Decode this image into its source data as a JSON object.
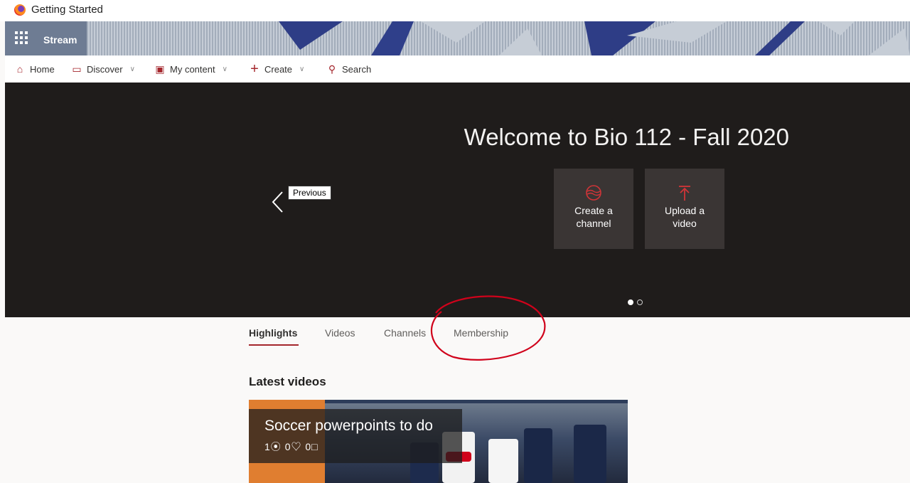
{
  "browser": {
    "tab_title": "Getting Started"
  },
  "suite": {
    "app_name": "Stream"
  },
  "nav": {
    "home": "Home",
    "discover": "Discover",
    "my_content": "My content",
    "create": "Create",
    "search": "Search"
  },
  "hero": {
    "title": "Welcome to Bio 112 - Fall 2020",
    "prev_tooltip": "Previous",
    "tiles": [
      {
        "line1": "Create a",
        "line2": "channel",
        "icon": "channel-icon"
      },
      {
        "line1": "Upload a",
        "line2": "video",
        "icon": "upload-icon"
      }
    ],
    "pager": {
      "count": 2,
      "active": 1
    }
  },
  "tabs": [
    "Highlights",
    "Videos",
    "Channels",
    "Membership"
  ],
  "active_tab": "Highlights",
  "latest": {
    "heading": "Latest videos",
    "video": {
      "title": "Soccer powerpoints to do",
      "views": "1",
      "likes": "0",
      "comments": "0"
    }
  },
  "colors": {
    "accent": "#a4262c",
    "hero_bg": "#1f1c1b",
    "annotation": "#d0021b"
  }
}
